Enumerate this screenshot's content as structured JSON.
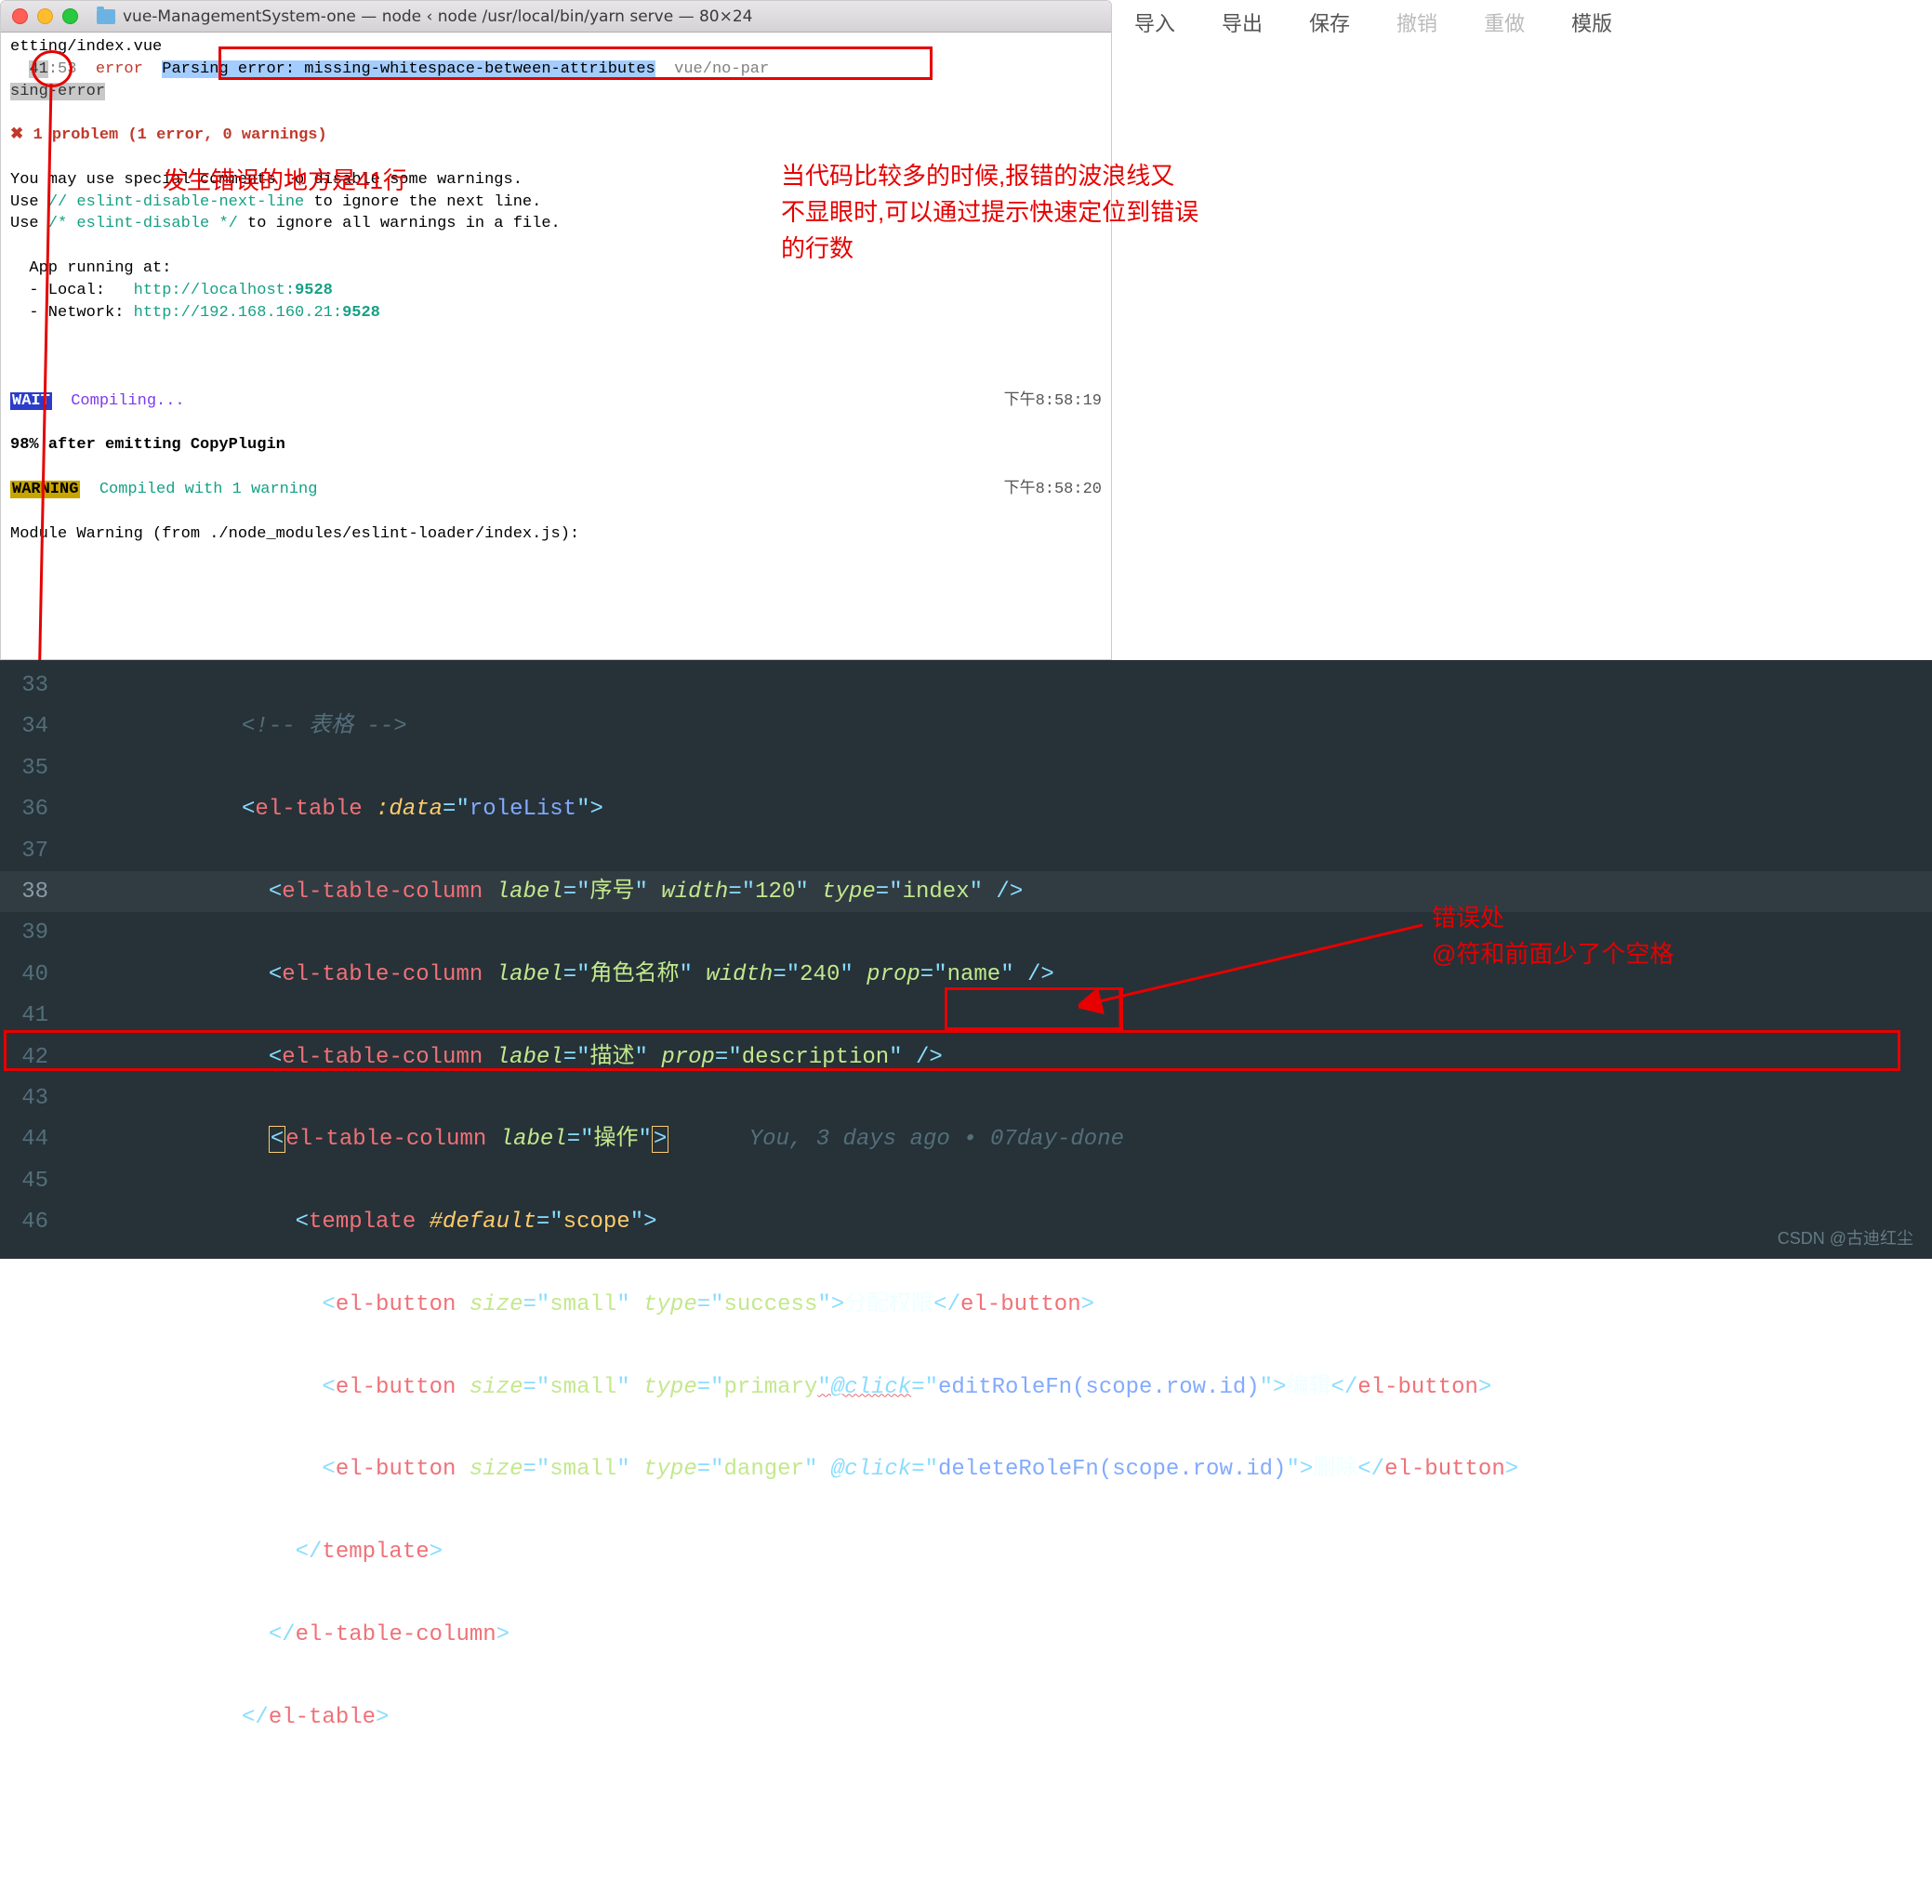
{
  "window": {
    "title": "vue-ManagementSystem-one — node ‹ node /usr/local/bin/yarn serve — 80×24"
  },
  "top_menu": {
    "import": "导入",
    "export": "导出",
    "save": "保存",
    "undo": "撤销",
    "redo": "重做",
    "template": "模版"
  },
  "term": {
    "file_path": "etting/index.vue",
    "loc_line": "41",
    "loc_col": ":53",
    "err_label": "error",
    "err_msg": "Parsing error: missing-whitespace-between-attributes",
    "rule_tail": "vue/no-par",
    "rule_tail2": "sing-error",
    "problem": "✖ 1 problem (1 error, 0 warnings)",
    "tip1": "You may use special comments to disable some warnings.",
    "tip2a": "Use ",
    "tip2b": "// eslint-disable-next-line",
    "tip2c": " to ignore the next line.",
    "tip3a": "Use ",
    "tip3b": "/* eslint-disable */",
    "tip3c": " to ignore all warnings in a file.",
    "app_running": "App running at:",
    "local_label": "- Local:   ",
    "local_url": "http://localhost:",
    "local_port": "9528",
    "net_label": "- Network: ",
    "net_url": "http://192.168.160.21:",
    "net_port": "9528",
    "wait": "WAIT",
    "compiling": " Compiling...",
    "ts1": "下午8:58:19",
    "progress": "98% after emitting CopyPlugin",
    "warning": "WARNING",
    "compiled_warn": " Compiled with 1 warning",
    "ts2": "下午8:58:20",
    "module_warn": "Module Warning (from ./node_modules/eslint-loader/index.js):"
  },
  "annotations": {
    "a1": "发生错误的地方是41行",
    "a2_l1": "当代码比较多的时候,报错的波浪线又",
    "a2_l2": "不显眼时,可以通过提示快速定位到错误",
    "a2_l3": "的行数",
    "a3_l1": "错误处",
    "a3_l2": "@符和前面少了个空格"
  },
  "editor": {
    "lines": [
      "33",
      "34",
      "35",
      "36",
      "37",
      "38",
      "39",
      "40",
      "41",
      "42",
      "43",
      "44",
      "45",
      "46"
    ],
    "current_line": "38",
    "blame": "You, 3 days ago • 07day-done",
    "comment": "<!-- 表格 -->",
    "code": {
      "roleList": "roleList",
      "label_index": "序号",
      "width_120": "120",
      "type_index": "index",
      "label_rolename": "角色名称",
      "width_240": "240",
      "prop_name": "name",
      "label_desc": "描述",
      "prop_desc": "description",
      "label_op": "操作",
      "scope": "scope",
      "small": "small",
      "success": "success",
      "primary": "primary",
      "danger": "danger",
      "btn_assign": "分配权限",
      "btn_edit": "编辑",
      "btn_delete": "删除",
      "edit_fn": "editRoleFn(scope.row.id)",
      "delete_fn": "deleteRoleFn(scope.row.id)"
    }
  },
  "watermark": "CSDN @古迪红尘"
}
